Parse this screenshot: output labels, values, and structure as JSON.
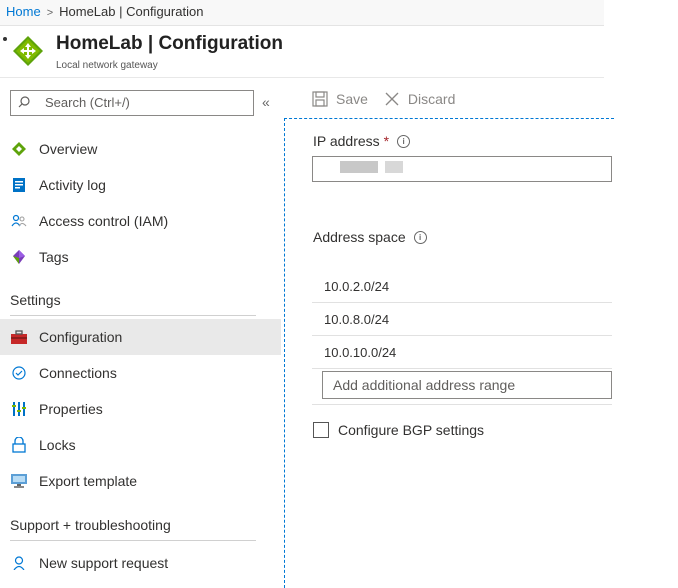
{
  "breadcrumb": {
    "home": "Home",
    "current": "HomeLab | Configuration"
  },
  "header": {
    "title": "HomeLab | Configuration",
    "subtitle": "Local network gateway"
  },
  "sidebar": {
    "search_placeholder": "Search (Ctrl+/)",
    "collapse_glyph": "«",
    "items": [
      {
        "label": "Overview",
        "icon": "diamond-icon"
      },
      {
        "label": "Activity log",
        "icon": "activity-log-icon"
      },
      {
        "label": "Access control (IAM)",
        "icon": "people-icon"
      },
      {
        "label": "Tags",
        "icon": "tag-icon"
      }
    ],
    "settings_section": "Settings",
    "settings_items": [
      {
        "label": "Configuration",
        "icon": "toolbox-icon",
        "active": true
      },
      {
        "label": "Connections",
        "icon": "connections-icon"
      },
      {
        "label": "Properties",
        "icon": "properties-icon"
      },
      {
        "label": "Locks",
        "icon": "lock-icon"
      },
      {
        "label": "Export template",
        "icon": "export-icon"
      }
    ],
    "support_section": "Support + troubleshooting",
    "support_items": [
      {
        "label": "New support request",
        "icon": "person-support-icon"
      }
    ]
  },
  "toolbar": {
    "save_label": "Save",
    "discard_label": "Discard"
  },
  "form": {
    "ip_label": "IP address",
    "required_marker": "*",
    "info_glyph": "i",
    "address_space_label": "Address space",
    "address_ranges": [
      "10.0.2.0/24",
      "10.0.8.0/24",
      "10.0.10.0/24"
    ],
    "add_range_placeholder": "Add additional address range",
    "bgp_label": "Configure BGP settings"
  },
  "colors": {
    "accent": "#0078d4",
    "required": "#a4262c",
    "active_bg": "#e9e9e9"
  }
}
